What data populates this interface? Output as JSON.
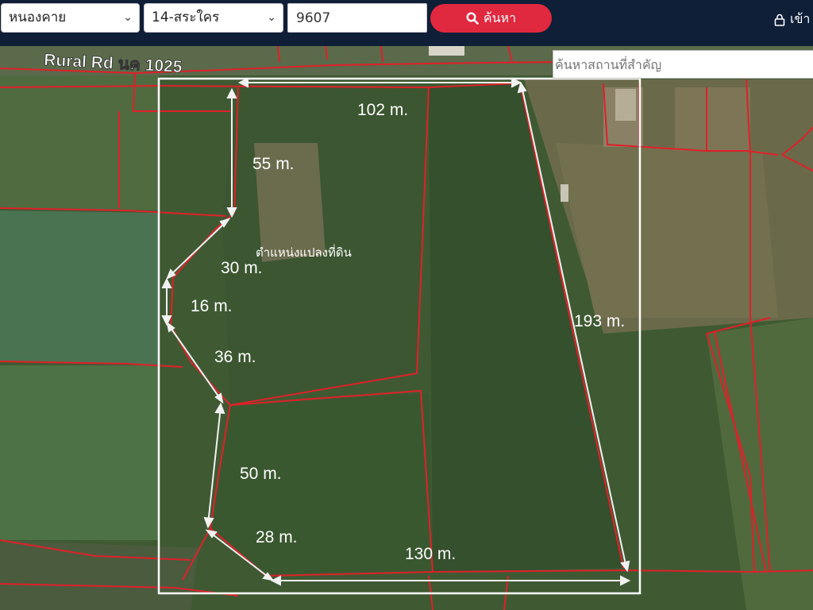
{
  "header": {
    "province_select": "หนองคาย",
    "district_select": "14-สระใคร",
    "parcel_number": "9607",
    "search_button": "ค้นหา",
    "login_label": "เข้า"
  },
  "map": {
    "landmark_search_placeholder": "ค้นหาสถานที่สำคัญ",
    "road_label": "Rural Rd นค 1025",
    "parcel_position_label": "ตำแหน่งแปลงที่ดิน",
    "measurements": [
      "102 m.",
      "55 m.",
      "30 m.",
      "16 m.",
      "36 m.",
      "50 m.",
      "28 m.",
      "130 m.",
      "193 m."
    ]
  },
  "colors": {
    "header_bg": "#0f1f38",
    "search_button": "#e0283f",
    "parcel_lines": "#e0202a",
    "measure_lines": "#ffffff"
  }
}
